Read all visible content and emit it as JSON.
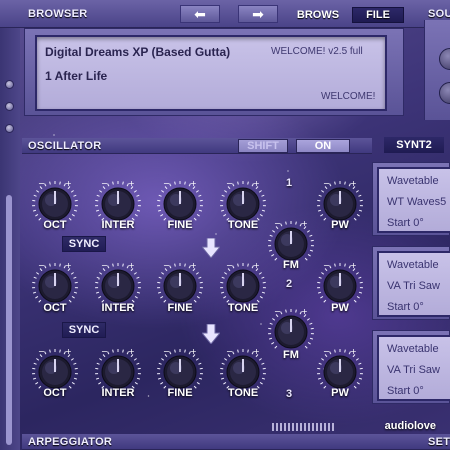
{
  "browser": {
    "title": "BROWSER",
    "tabs": {
      "browse": "BROWS",
      "file": "FILE"
    },
    "nav": {
      "prev_icon": "⬅",
      "next_icon": "➡"
    },
    "preset_name": "Digital Dreams XP (Based Gutta)",
    "preset_sub": "1 After Life",
    "version": "WELCOME! v2.5 full",
    "welcome": "WELCOME!"
  },
  "source_panel": {
    "title": "SOU"
  },
  "oscillator": {
    "title": "OSCILLATOR",
    "toggle_off": "SHIFT",
    "toggle_on": "ON",
    "synth_tab": "SYNT2",
    "sync_label": "SYNC",
    "rows": [
      {
        "number": "1",
        "labels": [
          "OCT",
          "INTER",
          "FINE",
          "TONE",
          "PW"
        ]
      },
      {
        "number": "2",
        "labels": [
          "OCT",
          "INTER",
          "FINE",
          "TONE",
          "FM",
          "PW"
        ]
      },
      {
        "number": "3",
        "labels": [
          "OCT",
          "INTER",
          "FINE",
          "TONE",
          "FM",
          "PW"
        ]
      }
    ],
    "wavetables": [
      {
        "type": "Wavetable",
        "name": "WT Waves5",
        "start": "Start 0°"
      },
      {
        "type": "Wavetable",
        "name": "VA Tri Saw",
        "start": "Start 0°"
      },
      {
        "type": "Wavetable",
        "name": "VA Tri Saw",
        "start": "Start 0°"
      }
    ]
  },
  "arpeggiator": {
    "title": "ARPEGGIATOR",
    "settings": "SET"
  },
  "watermark": "audiolove",
  "colors": {
    "accent": "#6b63a6",
    "screen": "#c8c2e8",
    "label": "#ffffff"
  }
}
